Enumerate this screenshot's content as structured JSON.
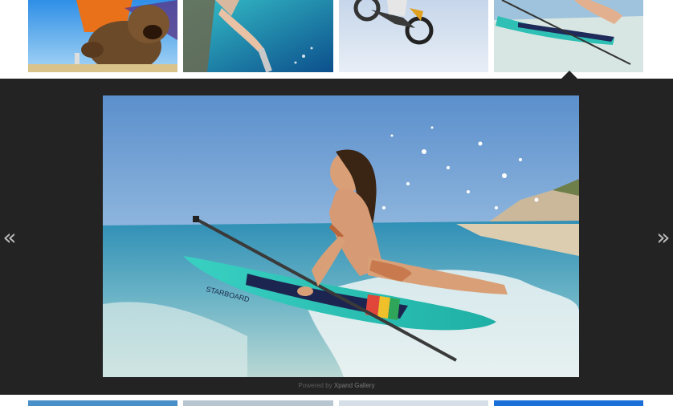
{
  "gallery": {
    "top_thumbnails": [
      {
        "id": "thumb-bear",
        "subject": "bear-costume-selfie"
      },
      {
        "id": "thumb-snorkel",
        "subject": "underwater-selfie"
      },
      {
        "id": "thumb-motocross",
        "subject": "motocross-jump"
      },
      {
        "id": "thumb-paddleboard",
        "subject": "paddleboard-surf",
        "selected": true
      }
    ],
    "bottom_thumbnails": [
      {
        "id": "thumb-b1"
      },
      {
        "id": "thumb-b2"
      },
      {
        "id": "thumb-b3"
      },
      {
        "id": "thumb-b4"
      }
    ]
  },
  "viewer": {
    "prev_label": "«",
    "next_label": "»",
    "powered_prefix": "Powered by",
    "powered_brand": "Xpand Gallery",
    "board_text": "STARBOARD"
  },
  "colors": {
    "viewer_bg": "#232323",
    "sky": "#6a9fd6",
    "sea": "#3fa3c4",
    "board": "#2fc0b5"
  }
}
